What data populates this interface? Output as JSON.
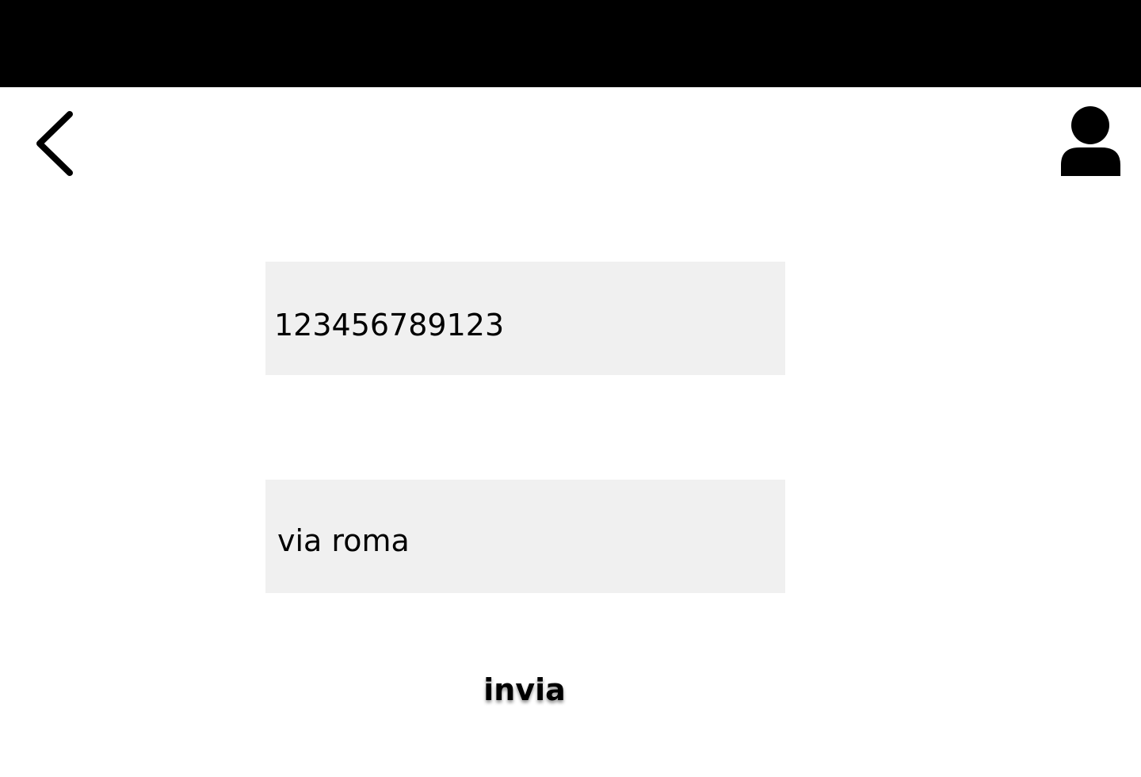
{
  "header": {
    "back_icon": "chevron-left-icon",
    "profile_icon": "user-icon",
    "bar_color": "#000000"
  },
  "form": {
    "field_1": {
      "value": "123456789123",
      "placeholder": ""
    },
    "field_2": {
      "value": "via roma",
      "placeholder": ""
    },
    "submit_label": "invia",
    "field_background": "#f0f0f0"
  }
}
